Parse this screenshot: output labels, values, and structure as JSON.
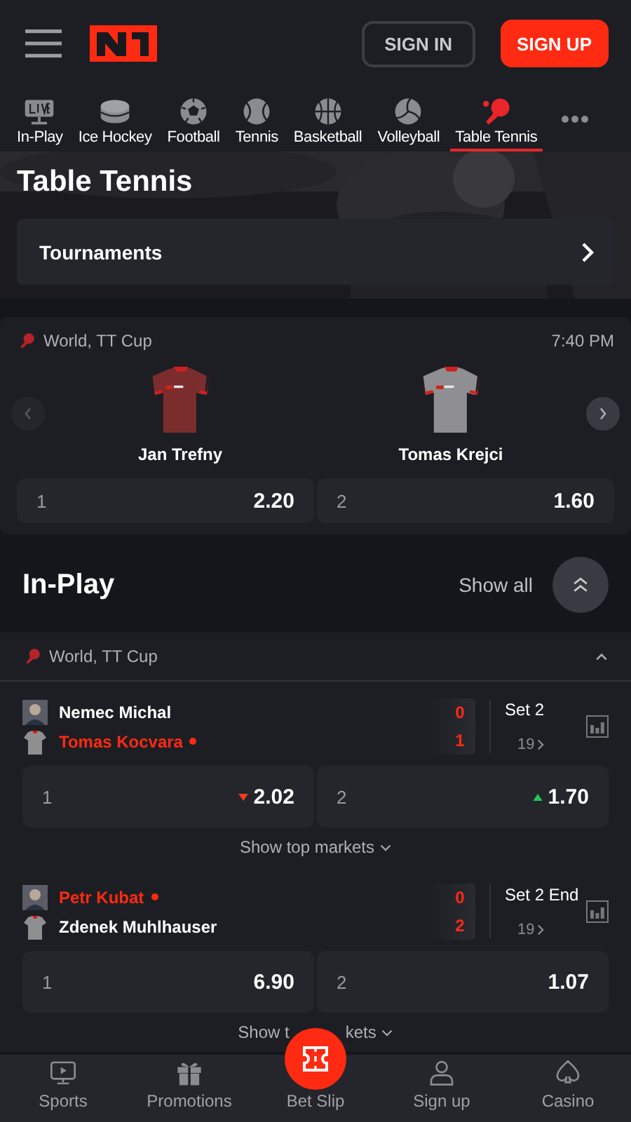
{
  "header": {
    "sign_in": "SIGN IN",
    "sign_up": "SIGN UP"
  },
  "sports_tabs": [
    {
      "label": "In-Play",
      "kind": "live",
      "selected": false
    },
    {
      "label": "Ice Hockey",
      "kind": "puck",
      "selected": false
    },
    {
      "label": "Football",
      "kind": "football",
      "selected": false
    },
    {
      "label": "Tennis",
      "kind": "tennis",
      "selected": false
    },
    {
      "label": "Basketball",
      "kind": "basketball",
      "selected": false
    },
    {
      "label": "Volleyball",
      "kind": "volleyball",
      "selected": false
    },
    {
      "label": "Table Tennis",
      "kind": "tabletennis",
      "selected": true
    }
  ],
  "hero": {
    "title": "Table Tennis",
    "tournaments": "Tournaments"
  },
  "featured": {
    "league": "World, TT Cup",
    "time": "7:40 PM",
    "teams": [
      {
        "name": "Jan Trefny",
        "kind": "dark"
      },
      {
        "name": "Tomas Krejci",
        "kind": "light"
      }
    ],
    "odds": [
      {
        "label": "1",
        "value": "2.20"
      },
      {
        "label": "2",
        "value": "1.60"
      }
    ]
  },
  "inplay": {
    "title": "In-Play",
    "show_all": "Show all",
    "league": "World, TT Cup",
    "expanded": true,
    "matches": [
      {
        "players": [
          {
            "name": "Nemec Michal",
            "serving": false
          },
          {
            "name": "Tomas Kocvara",
            "serving": true
          }
        ],
        "scores": [
          "0",
          "1"
        ],
        "set": "Set 2",
        "count": "19",
        "odds": [
          {
            "label": "1",
            "value": "2.02",
            "kind": "down"
          },
          {
            "label": "2",
            "value": "1.70",
            "kind": "up"
          }
        ],
        "more": [
          "Show top markets"
        ]
      },
      {
        "players": [
          {
            "name": "Petr Kubat",
            "serving": true
          },
          {
            "name": "Zdenek Muhlhauser",
            "serving": false
          }
        ],
        "scores": [
          "0",
          "2"
        ],
        "set": "Set 2 End",
        "count": "19",
        "odds": [
          {
            "label": "1",
            "value": "6.90",
            "kind": "flat"
          },
          {
            "label": "2",
            "value": "1.07",
            "kind": "flat"
          }
        ],
        "more": [
          "Show t",
          "kets"
        ]
      }
    ]
  },
  "nav": [
    {
      "label": "Sports",
      "kind": "sports"
    },
    {
      "label": "Promotions",
      "kind": "gift"
    },
    {
      "label": "Bet Slip",
      "kind": "betslip"
    },
    {
      "label": "Sign up",
      "kind": "user"
    },
    {
      "label": "Casino",
      "kind": "spade"
    }
  ]
}
